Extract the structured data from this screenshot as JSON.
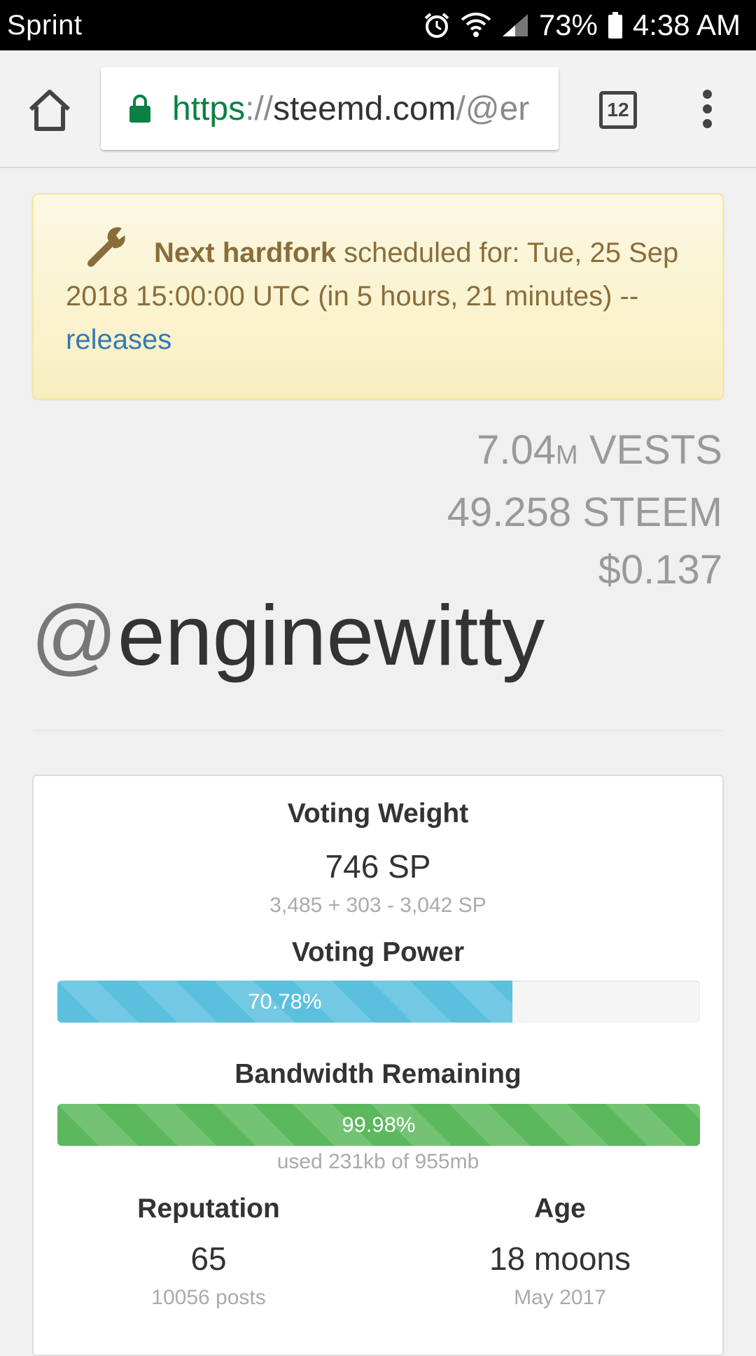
{
  "status_bar": {
    "carrier": "Sprint",
    "battery": "73%",
    "time": "4:38 AM"
  },
  "browser": {
    "url_scheme": "https",
    "url_separator": "://",
    "url_host": "steemd.com",
    "url_path": "/@er",
    "tab_count": "12"
  },
  "alert": {
    "strong": "Next hardfork",
    "text": " scheduled for: Tue, 25 Sep 2018 15:00:00 UTC (in 5 hours, 21 minutes) -- ",
    "link": "releases"
  },
  "balances": {
    "vests_value": "7.04",
    "vests_unit_small": "M",
    "vests_unit": " VESTS",
    "steem": "49.258 STEEM",
    "usd": "$0.137"
  },
  "profile": {
    "at": "@",
    "name": "enginewitty"
  },
  "stats": {
    "voting_weight_label": "Voting Weight",
    "voting_weight_value": "746 SP",
    "voting_weight_detail": "3,485 + 303 - 3,042 SP",
    "voting_power_label": "Voting Power",
    "voting_power_text": "70.78%",
    "voting_power_fraction": 0.7078,
    "bandwidth_label": "Bandwidth Remaining",
    "bandwidth_text": "99.98%",
    "bandwidth_fraction": 0.9998,
    "bandwidth_detail": "used 231kb of 955mb",
    "reputation_label": "Reputation",
    "reputation_value": "65",
    "reputation_detail": "10056 posts",
    "age_label": "Age",
    "age_value": "18 moons",
    "age_detail": "May 2017"
  }
}
